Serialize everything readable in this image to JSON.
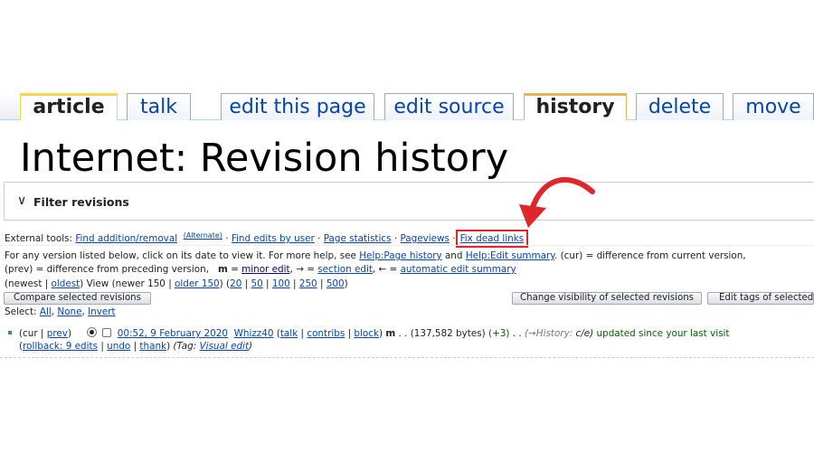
{
  "tabs": [
    {
      "label": "article",
      "selected": true
    },
    {
      "label": "talk"
    },
    {
      "label": "edit this page"
    },
    {
      "label": "edit source"
    },
    {
      "label": "history",
      "selected": true
    },
    {
      "label": "delete"
    },
    {
      "label": "move"
    }
  ],
  "page_title": "Internet: Revision history",
  "filter_label": "Filter revisions",
  "external_tools": {
    "prefix": "External tools:",
    "find_addition": "Find addition/removal",
    "alternate": "(Alternate)",
    "find_edits_by_user": "Find edits by user",
    "page_statistics": "Page statistics",
    "pageviews": "Pageviews",
    "fix_dead_links": "Fix dead links",
    "separator": "·"
  },
  "help": {
    "l1_a": "For any version listed below, click on its date to view it. For more help, see",
    "help_page_history": "Help:Page history",
    "and": "and",
    "help_edit_summary": "Help:Edit summary",
    "l1_b": ". (cur) = difference from current version,",
    "l2_a": "(prev) = difference from preceding version,",
    "m": "m",
    "l2_eq": "=",
    "minor_edit": "minor edit",
    "l2_b": ", → =",
    "section_edit": "section edit",
    "l2_c": ", ← =",
    "automatic_edit_summary": "automatic edit summary"
  },
  "paging": {
    "prefix": "(newest |",
    "oldest": "oldest",
    "mid": ") View (newer 150 |",
    "older": "older 150",
    "mid2": ") (",
    "n20": "20",
    "n50": "50",
    "n100": "100",
    "n250": "250",
    "n500": "500",
    "sep": "|",
    "suffix": ")"
  },
  "buttons": {
    "compare": "Compare selected revisions",
    "change_visibility": "Change visibility of selected revisions",
    "edit_tags": "Edit tags of selected r"
  },
  "select": {
    "prefix": "Select:",
    "all": "All",
    "none": "None",
    "invert": "Invert"
  },
  "revision": {
    "cur": "(cur |",
    "prev": "prev",
    "close": ")",
    "date": "00:52, 9 February 2020",
    "user": "Whizz40",
    "talk": "talk",
    "contribs": "contribs",
    "block": "block",
    "minor": "m",
    "size": ". . (137,582 bytes)",
    "diff": "(+3)",
    "dots": ". .",
    "section": "(→History:",
    "summary": "c/e)",
    "updated": "updated since your last visit",
    "rollback": "rollback: 9 edits",
    "undo": "undo",
    "thank": "thank",
    "tag_prefix": "(Tag:",
    "tag": "Visual edit",
    "tag_close": ")"
  },
  "colors": {
    "link": "#0645ad",
    "visited": "#0b0080",
    "highlight": "#e0262b",
    "green": "#006400",
    "tab_gold": "#fbd44f"
  }
}
